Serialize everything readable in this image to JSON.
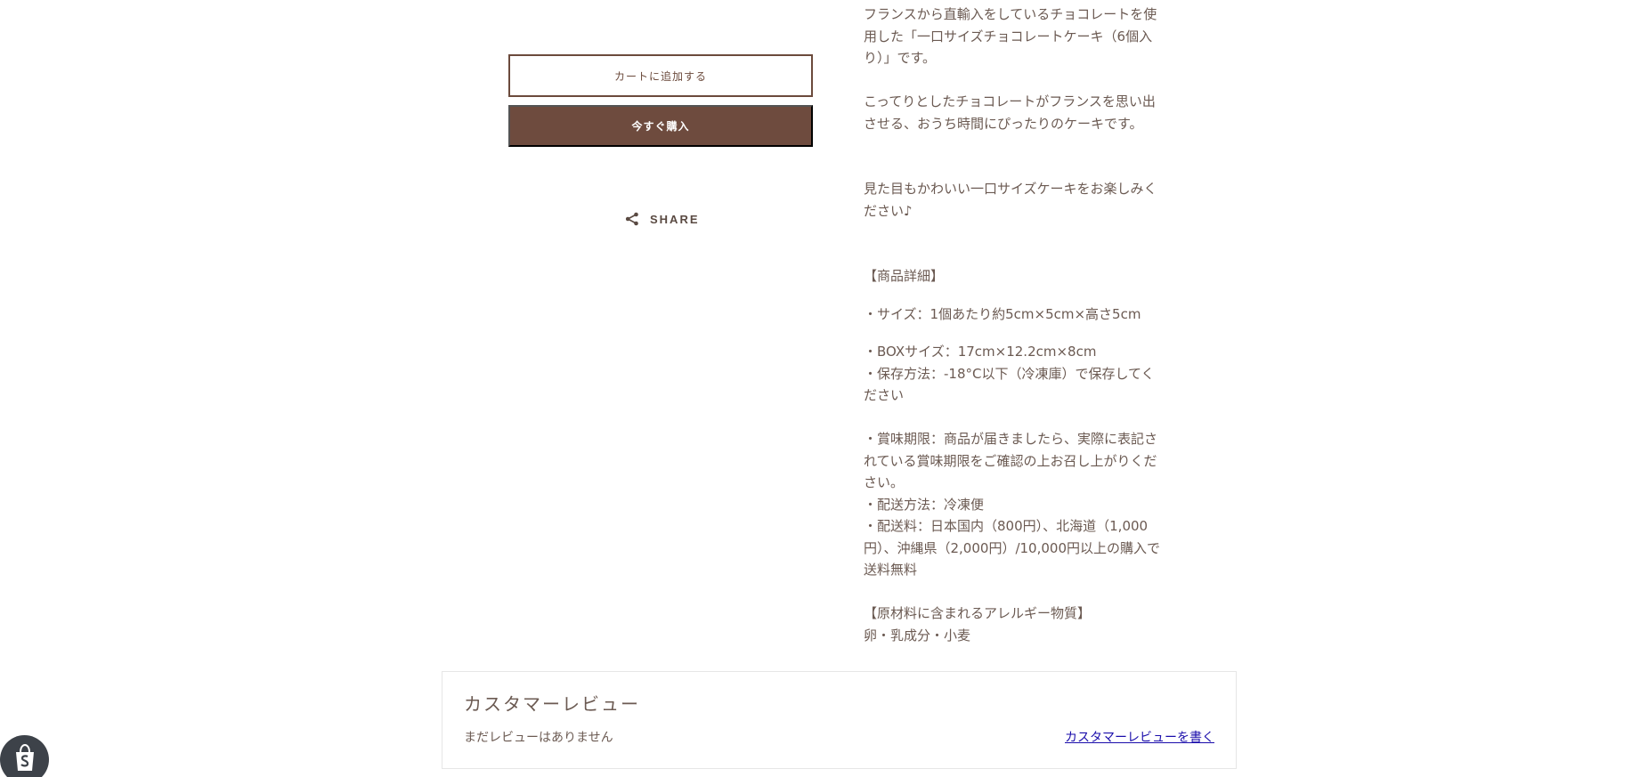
{
  "product": {
    "add_to_cart_label": "カートに追加する",
    "buy_now_label": "今すぐ購入",
    "share_label": "SHARE"
  },
  "description": {
    "paragraphs": [
      "フランスから直輸入をしているチョコレートを使用した「一口サイズチョコレートケーキ（6個入り）」です。\n\nこってりとしたチョコレートがフランスを思い出させる、おうち時間にぴったりのケーキです。\n\n\n見た目もかわいい一口サイズケーキをお楽しみください♪\n\n\n【商品詳細】",
      "・サイズ：1個あたり約5cm×5cm×高さ5cm",
      "・BOXサイズ：17cm×12.2cm×8cm\n・保存方法：-18°C以下（冷凍庫）で保存してください\n\n・賞味期限：商品が届きましたら、実際に表記されている賞味期限をご確認の上お召し上がりください。\n・配送方法：冷凍便\n・配送料：日本国内（800円）、北海道（1,000円）、沖縄県（2,000円）/10,000円以上の購入で送料無料\n\n【原材料に含まれるアレルギー物質】\n卵・乳成分・小麦"
    ]
  },
  "reviews": {
    "title": "カスタマーレビュー",
    "empty_text": "まだレビューはありません",
    "write_link": "カスタマーレビューを書く"
  },
  "icons": {
    "share": "share-icon",
    "shopify": "shopify-bag-icon"
  },
  "colors": {
    "brand_brown": "#6e4b3e",
    "text": "#6b5a52",
    "link": "#1a0dab",
    "badge": "#3d4249"
  }
}
